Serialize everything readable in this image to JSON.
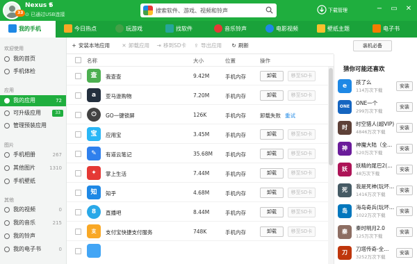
{
  "device": {
    "name": "Nexus 5",
    "status": "已通过USB连接",
    "badge": "33"
  },
  "search": {
    "placeholder": "搜索软件、游戏、视频和铃声"
  },
  "download_label": "下载管理",
  "window_controls": {
    "minimize": "−",
    "restore": "▭",
    "close": "✕"
  },
  "nav_tabs": [
    {
      "label": "我的手机",
      "icon": "phone-icon",
      "color": "#1e88e5"
    },
    {
      "label": "今日热点",
      "icon": "star-icon",
      "color": "#f9a825"
    },
    {
      "label": "玩游戏",
      "icon": "gamepad-icon",
      "color": "#43a047"
    },
    {
      "label": "找软件",
      "icon": "software-icon",
      "color": "#26a69a"
    },
    {
      "label": "音乐铃声",
      "icon": "music-icon",
      "color": "#e53935"
    },
    {
      "label": "电影视频",
      "icon": "video-icon",
      "color": "#1e88e5"
    },
    {
      "label": "壁纸主题",
      "icon": "wallpaper-icon",
      "color": "#fbc02d"
    },
    {
      "label": "电子书",
      "icon": "book-icon",
      "color": "#f57c00"
    }
  ],
  "sidebar": {
    "groups": {
      "welcome": "欢迎使用",
      "apps": "应用",
      "images": "图片",
      "other": "其他"
    },
    "items": [
      {
        "label": "我的首页",
        "count": ""
      },
      {
        "label": "手机体检",
        "count": ""
      },
      {
        "label": "我的应用",
        "count": "72"
      },
      {
        "label": "可升级应用",
        "count": "33"
      },
      {
        "label": "管理预装应用",
        "count": ""
      },
      {
        "label": "手机相册",
        "count": "267"
      },
      {
        "label": "其他图片",
        "count": "1310"
      },
      {
        "label": "手机壁纸",
        "count": ""
      },
      {
        "label": "我的视频",
        "count": "0"
      },
      {
        "label": "我的音乐",
        "count": "215"
      },
      {
        "label": "我的铃声",
        "count": ""
      },
      {
        "label": "我的电子书",
        "count": "0"
      }
    ]
  },
  "toolbar": {
    "install": "安装本地应用",
    "uninstall": "卸载应用",
    "move_sd": "移到SD卡",
    "export": "导出应用",
    "refresh": "刷新",
    "essentials": "装机必备"
  },
  "table": {
    "headers": {
      "name": "名称",
      "size": "大小",
      "location": "位置",
      "action": "操作"
    },
    "uninstall_label": "卸载",
    "move_label": "移至SD卡",
    "fail_label": "卸载失败",
    "retry_label": "重试",
    "rows": [
      {
        "name": "我查查",
        "size": "9.42M",
        "location": "手机内存",
        "icon_text": "查",
        "color": "#4caf50",
        "failed": false
      },
      {
        "name": "亚马逊购物",
        "size": "7.20M",
        "location": "手机内存",
        "icon_text": "a",
        "color": "#232f3e",
        "failed": false
      },
      {
        "name": "GO一键锁屏",
        "size": "126K",
        "location": "手机内存",
        "icon_text": "⏻",
        "color": "#424242",
        "failed": true
      },
      {
        "name": "应用宝",
        "size": "3.45M",
        "location": "手机内存",
        "icon_text": "宝",
        "color": "#29b6f6",
        "failed": false
      },
      {
        "name": "有道云笔记",
        "size": "35.68M",
        "location": "手机内存",
        "icon_text": "✎",
        "color": "#2f80ed",
        "failed": false
      },
      {
        "name": "掌上生活",
        "size": "7.44M",
        "location": "手机内存",
        "icon_text": "✦",
        "color": "#e53935",
        "failed": false
      },
      {
        "name": "知乎",
        "size": "4.68M",
        "location": "手机内存",
        "icon_text": "知",
        "color": "#1e88e5",
        "failed": false
      },
      {
        "name": "直播吧",
        "size": "8.44M",
        "location": "手机内存",
        "icon_text": "8",
        "color": "#29a8e8",
        "failed": false
      },
      {
        "name": "支付宝快捷支付服务",
        "size": "748K",
        "location": "手机内存",
        "icon_text": "支",
        "color": "#f9a825",
        "failed": false
      },
      {
        "name": "",
        "size": "",
        "location": "",
        "icon_text": "",
        "color": "#42a5f5",
        "failed": false
      }
    ]
  },
  "recommend": {
    "title": "猜你可能还喜欢",
    "install_label": "安装",
    "items": [
      {
        "name": "孩了么",
        "downloads": "114万次下载",
        "icon_text": "e",
        "color": "#1e88e5"
      },
      {
        "name": "ONE一个",
        "downloads": "299万次下载",
        "icon_text": "ONE",
        "color": "#1565c0"
      },
      {
        "name": "时空猎人(超VIP)",
        "downloads": "4846万次下载",
        "icon_text": "时",
        "color": "#5d4037"
      },
      {
        "name": "神魔大陆（全...",
        "downloads": "520万次下载",
        "icon_text": "神",
        "color": "#6a1b9a"
      },
      {
        "name": "妖精的尾巴2(...",
        "downloads": "48万次下载",
        "icon_text": "妖",
        "color": "#ad1457"
      },
      {
        "name": "我是死神(玩坏...",
        "downloads": "1416万次下载",
        "icon_text": "死",
        "color": "#455a64"
      },
      {
        "name": "海岛奇兵(玩坏...",
        "downloads": "1022万次下载",
        "icon_text": "岛",
        "color": "#0277bd"
      },
      {
        "name": "秦时明月2.0",
        "downloads": "125万次下载",
        "icon_text": "秦",
        "color": "#8d6e63"
      },
      {
        "name": "刀塔传奇-全...",
        "downloads": "3252万次下载",
        "icon_text": "刀",
        "color": "#bf360c"
      }
    ]
  }
}
